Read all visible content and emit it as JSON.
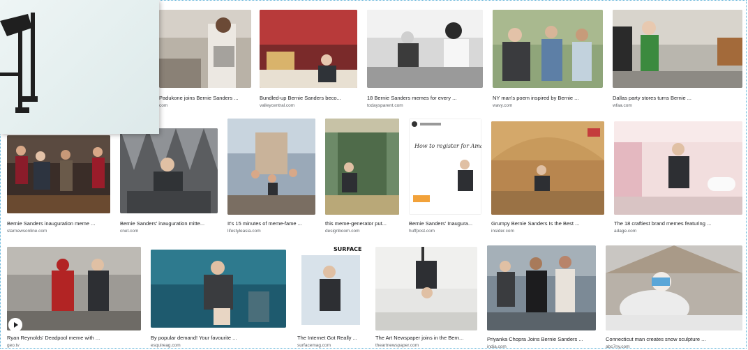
{
  "results": [
    {
      "caption": "Padukone joins Bernie Sanders ...",
      "source": "com"
    },
    {
      "caption": "Bundled-up Bernie Sanders beco...",
      "source": "valleycentral.com"
    },
    {
      "caption": "18 Bernie Sanders memes for every ...",
      "source": "todaysparent.com"
    },
    {
      "caption": "NY man's poem inspired by Bernie ...",
      "source": "wavy.com"
    },
    {
      "caption": "Dallas party stores turns Bernie ...",
      "source": "wfaa.com"
    },
    {
      "caption": "Bernie Sanders inauguration meme ...",
      "source": "starnewsonline.com"
    },
    {
      "caption": "Bernie Sanders' inauguration mitte...",
      "source": "cnet.com"
    },
    {
      "caption": "It's 15 minutes of meme-fame ...",
      "source": "lifestyleasia.com"
    },
    {
      "caption": "this meme-generator put...",
      "source": "designboom.com"
    },
    {
      "caption": "Bernie Sanders' Inaugura...",
      "source": "huffpost.com"
    },
    {
      "caption": "Grumpy Bernie Sanders Is the Best ...",
      "source": "insider.com"
    },
    {
      "caption": "The 18 craftiest brand memes featuring ...",
      "source": "adage.com"
    },
    {
      "caption": "Ryan Reynolds' Deadpool meme with ...",
      "source": "geo.tv"
    },
    {
      "caption": "By popular demand! Your favourite ...",
      "source": "esquireag.com"
    },
    {
      "caption": "The Internet Got Really ...",
      "source": "surfacemag.com"
    },
    {
      "caption": "The Art Newspaper joins in the Bern...",
      "source": "theartnewspaper.com"
    },
    {
      "caption": "Priyanka Chopra Joins Bernie Sanders ...",
      "source": "india.com"
    },
    {
      "caption": "Connecticut man creates snow sculpture ...",
      "source": "abc7ny.com"
    }
  ],
  "thumb_text": {
    "amazon_title": "How to register for Amazon Pay",
    "surface_label": "SURFACE"
  },
  "icons": {
    "play": "play-icon"
  },
  "colors": {
    "frame": "#5ab0d8",
    "caption": "#202124",
    "source": "#5f6368"
  }
}
